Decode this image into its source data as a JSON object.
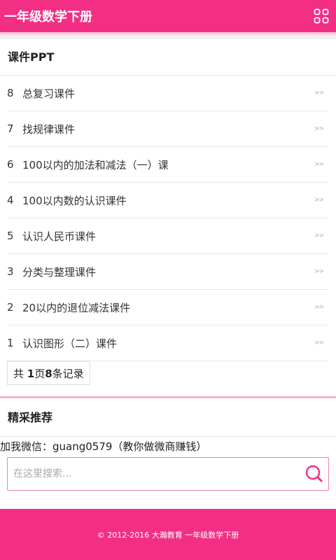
{
  "header": {
    "title": "一年级数学下册",
    "menu_icon": "grid-icon"
  },
  "section_courseware": {
    "title": "课件PPT",
    "items": [
      {
        "num": "8",
        "title": "总复习课件"
      },
      {
        "num": "7",
        "title": "找规律课件"
      },
      {
        "num": "6",
        "title": "100以内的加法和减法（一）课"
      },
      {
        "num": "4",
        "title": "100以内数的认识课件"
      },
      {
        "num": "5",
        "title": "认识人民币课件"
      },
      {
        "num": "3",
        "title": "分类与整理课件"
      },
      {
        "num": "2",
        "title": "20以内的退位减法课件"
      },
      {
        "num": "1",
        "title": "认识图形（二）课件"
      }
    ],
    "arrow": ">>",
    "pager": {
      "prefix": "共 ",
      "pages": "1",
      "mid": "页",
      "records": "8",
      "suffix": "条记录"
    }
  },
  "section_recommend": {
    "title": "精采推荐",
    "wechat_text": "加我微信：guang0579（教你做微商赚钱）"
  },
  "search": {
    "placeholder": "在这里搜索...",
    "value": "",
    "icon": "search-icon"
  },
  "footer": {
    "text": "© 2012-2016 大瀚教育  一年级数学下册"
  },
  "colors": {
    "brand": "#f22f84",
    "accent_light": "#f5b3d0"
  }
}
